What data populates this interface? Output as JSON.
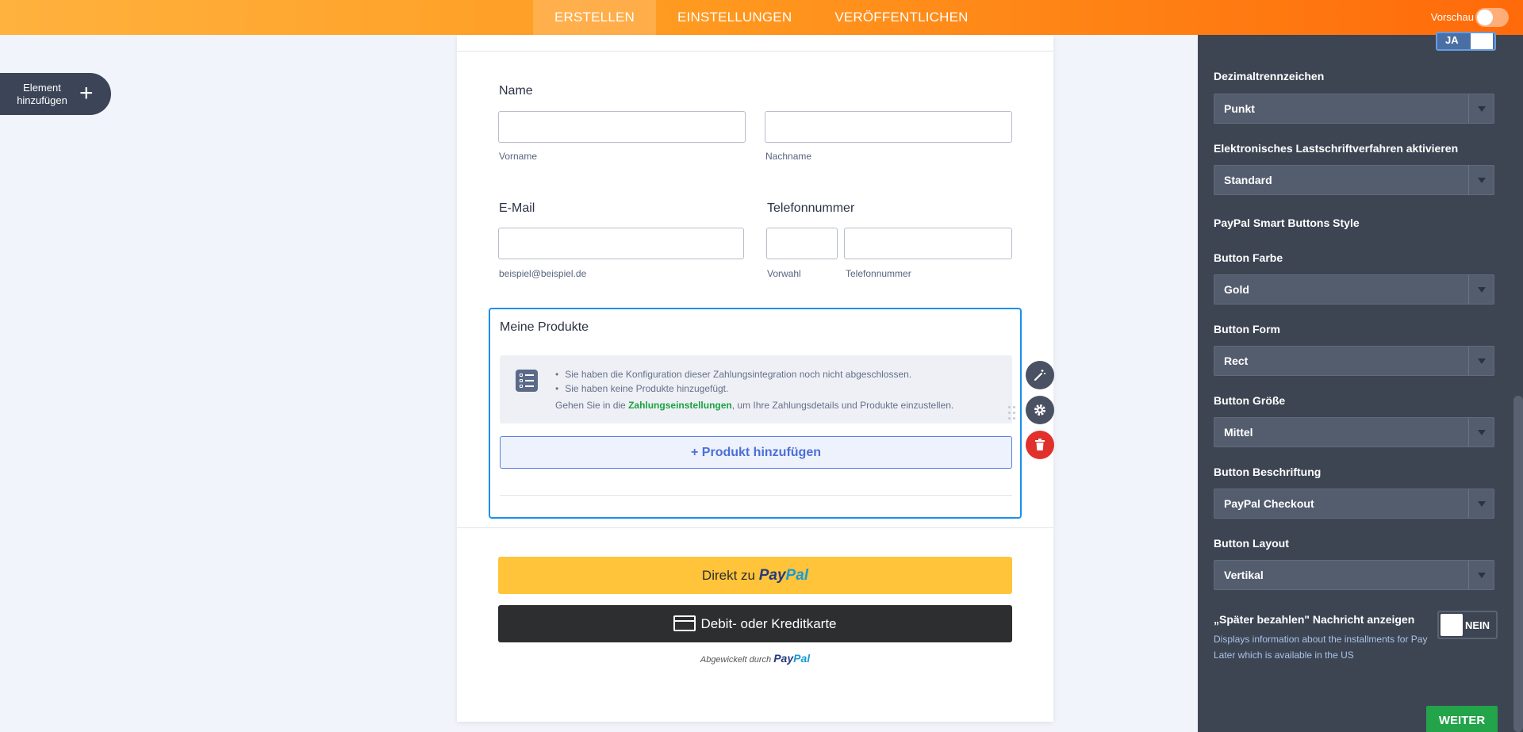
{
  "topbar": {
    "tabs": [
      "ERSTELLEN",
      "EINSTELLUNGEN",
      "VERÖFFENTLICHEN"
    ],
    "active_tab": "ERSTELLEN",
    "preview_label": "Vorschau",
    "preview_on": false
  },
  "add_element": {
    "label": "Element hinzufügen"
  },
  "form": {
    "name_label": "Name",
    "first_name_sub": "Vorname",
    "last_name_sub": "Nachname",
    "email_label": "E-Mail",
    "email_sub": "beispiel@beispiel.de",
    "phone_label": "Telefonnummer",
    "area_code_sub": "Vorwahl",
    "phone_sub": "Telefonnummer",
    "products": {
      "title": "Meine Produkte",
      "notice_items": [
        "Sie haben die Konfiguration dieser Zahlungsintegration noch nicht abgeschlossen.",
        "Sie haben keine Produkte hinzugefügt."
      ],
      "hint_before": "Gehen Sie in die ",
      "hint_link": "Zahlungseinstellungen",
      "hint_after": ", um Ihre Zahlungsdetails und Produkte einzustellen.",
      "add_product": "+ Produkt hinzufügen"
    },
    "paypal": {
      "direct_text": "Direkt zu",
      "logo_pay": "Pay",
      "logo_pal": "Pal",
      "card_text": "Debit- oder Kreditkarte",
      "powered_text": "Abgewickelt durch"
    }
  },
  "panel": {
    "ja_label": "JA",
    "decimal_label": "Dezimaltrennzeichen",
    "decimal_value": "Punkt",
    "sepa_label": "Elektronisches Lastschriftverfahren aktivieren",
    "sepa_value": "Standard",
    "style_heading": "PayPal Smart Buttons Style",
    "color_label": "Button Farbe",
    "color_value": "Gold",
    "shape_label": "Button Form",
    "shape_value": "Rect",
    "size_label": "Button Größe",
    "size_value": "Mittel",
    "caption_label": "Button Beschriftung",
    "caption_value": "PayPal Checkout",
    "layout_label": "Button Layout",
    "layout_value": "Vertikal",
    "paylater_label": "„Später bezahlen\" Nachricht anzeigen",
    "paylater_toggle": "NEIN",
    "paylater_desc": "Displays information about the installments for Pay Later which is available in the US",
    "next_button": "WEITER"
  },
  "colors": {
    "accent_orange": "#ff8a1a",
    "panel_bg": "#3d4553",
    "selection_blue": "#1a8ff0",
    "paypal_gold": "#ffc439",
    "next_green": "#23a34a"
  }
}
